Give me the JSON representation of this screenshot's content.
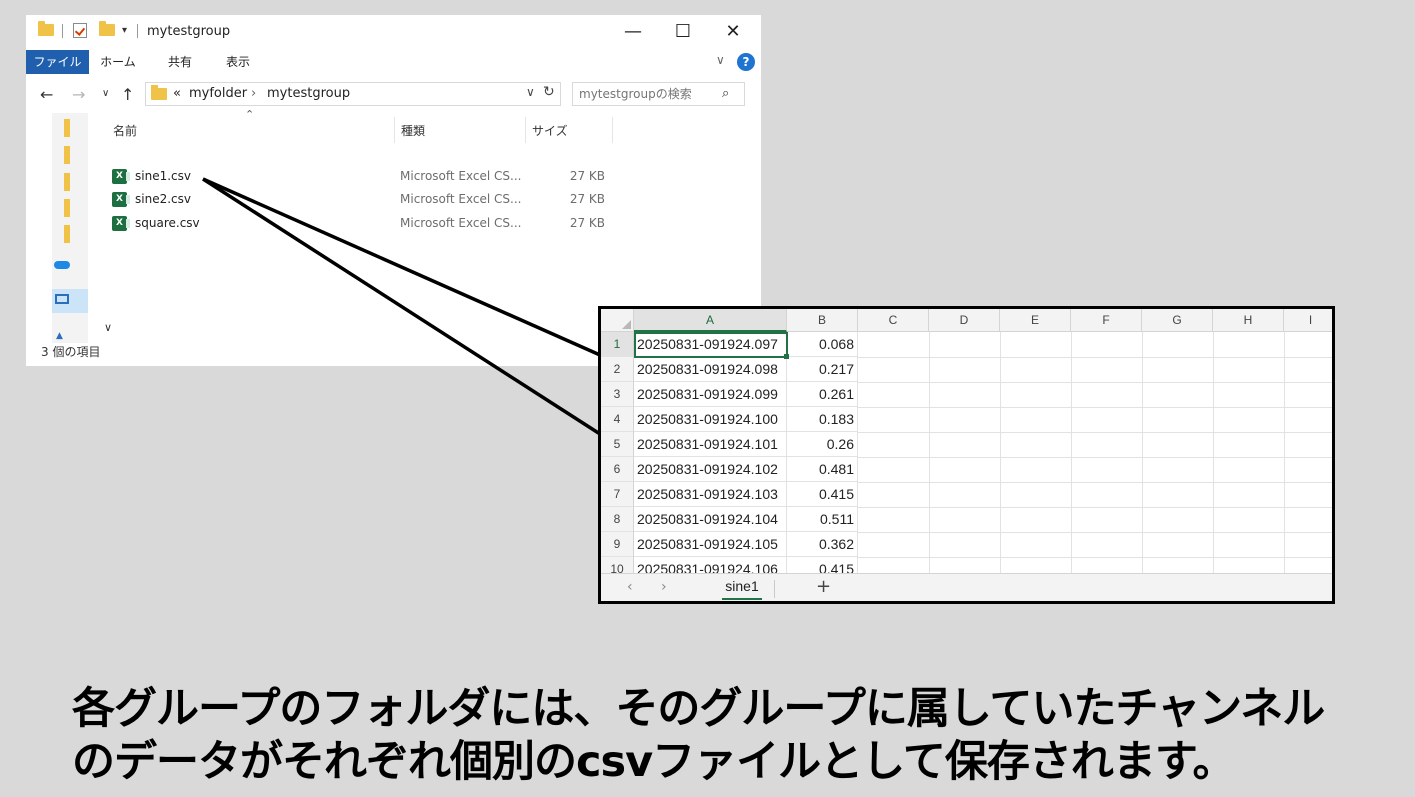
{
  "explorer": {
    "title": "mytestgroup",
    "ribbon_tabs": [
      "ファイル",
      "ホーム",
      "共有",
      "表示"
    ],
    "breadcrumb": {
      "prefix": "«",
      "items": [
        "myfolder",
        "mytestgroup"
      ]
    },
    "search_placeholder": "mytestgroupの検索",
    "columns": {
      "name": "名前",
      "type": "種類",
      "size": "サイズ"
    },
    "files": [
      {
        "name": "sine1.csv",
        "type": "Microsoft Excel CS...",
        "size": "27 KB"
      },
      {
        "name": "sine2.csv",
        "type": "Microsoft Excel CS...",
        "size": "27 KB"
      },
      {
        "name": "square.csv",
        "type": "Microsoft Excel CS...",
        "size": "27 KB"
      }
    ],
    "status": "3 個の項目",
    "icons": {
      "window": [
        "folder-icon",
        "properties-icon",
        "new-folder-icon",
        "minimize-icon",
        "maximize-icon",
        "close-icon"
      ],
      "nav": [
        "back-arrow-icon",
        "forward-arrow-icon",
        "recent-chevron-icon",
        "up-arrow-icon",
        "refresh-icon",
        "search-icon",
        "help-icon"
      ]
    },
    "accent_color": "#1f5fad"
  },
  "spreadsheet": {
    "columns": [
      "A",
      "B",
      "C",
      "D",
      "E",
      "F",
      "G",
      "H",
      "I"
    ],
    "rows": [
      {
        "n": "1",
        "a": "20250831-091924.097",
        "b": "0.068"
      },
      {
        "n": "2",
        "a": "20250831-091924.098",
        "b": "0.217"
      },
      {
        "n": "3",
        "a": "20250831-091924.099",
        "b": "0.261"
      },
      {
        "n": "4",
        "a": "20250831-091924.100",
        "b": "0.183"
      },
      {
        "n": "5",
        "a": "20250831-091924.101",
        "b": "0.26"
      },
      {
        "n": "6",
        "a": "20250831-091924.102",
        "b": "0.481"
      },
      {
        "n": "7",
        "a": "20250831-091924.103",
        "b": "0.415"
      },
      {
        "n": "8",
        "a": "20250831-091924.104",
        "b": "0.511"
      },
      {
        "n": "9",
        "a": "20250831-091924.105",
        "b": "0.362"
      },
      {
        "n": "10",
        "a": "20250831-091924.106",
        "b": "0.415"
      }
    ],
    "sheet_tab": "sine1",
    "active_cell": "A1",
    "accent_color": "#217346"
  },
  "caption": {
    "line1": "各グループのフォルダには、そのグループに属していたチャンネル",
    "line2": "のデータがそれぞれ個別のcsvファイルとして保存されます。"
  }
}
